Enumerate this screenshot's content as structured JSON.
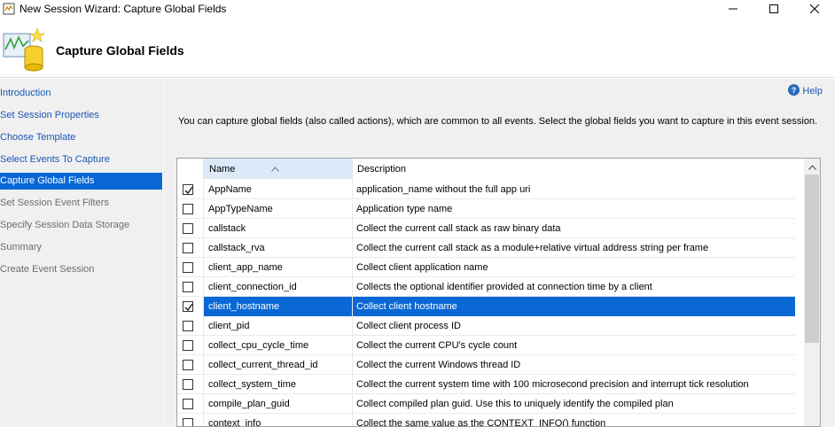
{
  "window": {
    "title": "New Session Wizard: Capture Global Fields",
    "controls": {
      "minimize_icon": "minimize-icon",
      "maximize_icon": "maximize-icon",
      "close_icon": "close-icon"
    }
  },
  "header": {
    "heading": "Capture Global Fields",
    "logo_icon": "wizard-logo-icon"
  },
  "nav": {
    "items": [
      {
        "label": "Introduction",
        "state": "link"
      },
      {
        "label": "Set Session Properties",
        "state": "link"
      },
      {
        "label": "Choose Template",
        "state": "link"
      },
      {
        "label": "Select Events To Capture",
        "state": "link"
      },
      {
        "label": "Capture Global Fields",
        "state": "selected"
      },
      {
        "label": "Set Session Event Filters",
        "state": "disabled"
      },
      {
        "label": "Specify Session Data Storage",
        "state": "disabled"
      },
      {
        "label": "Summary",
        "state": "disabled"
      },
      {
        "label": "Create Event Session",
        "state": "disabled"
      }
    ]
  },
  "main": {
    "help_label": "Help",
    "description": "You can capture global fields (also called actions), which are common to all events. Select the global fields you want to capture in this event session."
  },
  "grid": {
    "columns": {
      "name": "Name",
      "description": "Description"
    },
    "rows": [
      {
        "checked": true,
        "selected": false,
        "name": "AppName",
        "description": "application_name without the full app uri"
      },
      {
        "checked": false,
        "selected": false,
        "name": "AppTypeName",
        "description": "Application type name"
      },
      {
        "checked": false,
        "selected": false,
        "name": "callstack",
        "description": "Collect the current call stack as raw binary data"
      },
      {
        "checked": false,
        "selected": false,
        "name": "callstack_rva",
        "description": "Collect the current call stack as a module+relative virtual address string per frame"
      },
      {
        "checked": false,
        "selected": false,
        "name": "client_app_name",
        "description": "Collect client application name"
      },
      {
        "checked": false,
        "selected": false,
        "name": "client_connection_id",
        "description": "Collects the optional identifier provided at connection time by a client"
      },
      {
        "checked": true,
        "selected": true,
        "name": "client_hostname",
        "description": "Collect client hostname"
      },
      {
        "checked": false,
        "selected": false,
        "name": "client_pid",
        "description": "Collect client process ID"
      },
      {
        "checked": false,
        "selected": false,
        "name": "collect_cpu_cycle_time",
        "description": "Collect the current CPU's cycle count"
      },
      {
        "checked": false,
        "selected": false,
        "name": "collect_current_thread_id",
        "description": "Collect the current Windows thread ID"
      },
      {
        "checked": false,
        "selected": false,
        "name": "collect_system_time",
        "description": "Collect the current system time with 100 microsecond precision and interrupt tick resolution"
      },
      {
        "checked": false,
        "selected": false,
        "name": "compile_plan_guid",
        "description": "Collect compiled plan guid. Use this to uniquely identify the compiled plan"
      },
      {
        "checked": false,
        "selected": false,
        "name": "context_info",
        "description": "Collect the same value as the CONTEXT_INFO() function"
      }
    ]
  },
  "colors": {
    "selection": "#0a68d6",
    "link": "#1a57b8",
    "disabled": "#6d6d6d",
    "panel_bg": "#f0f0f0",
    "header_sorted_bg": "#dbe9f8"
  }
}
